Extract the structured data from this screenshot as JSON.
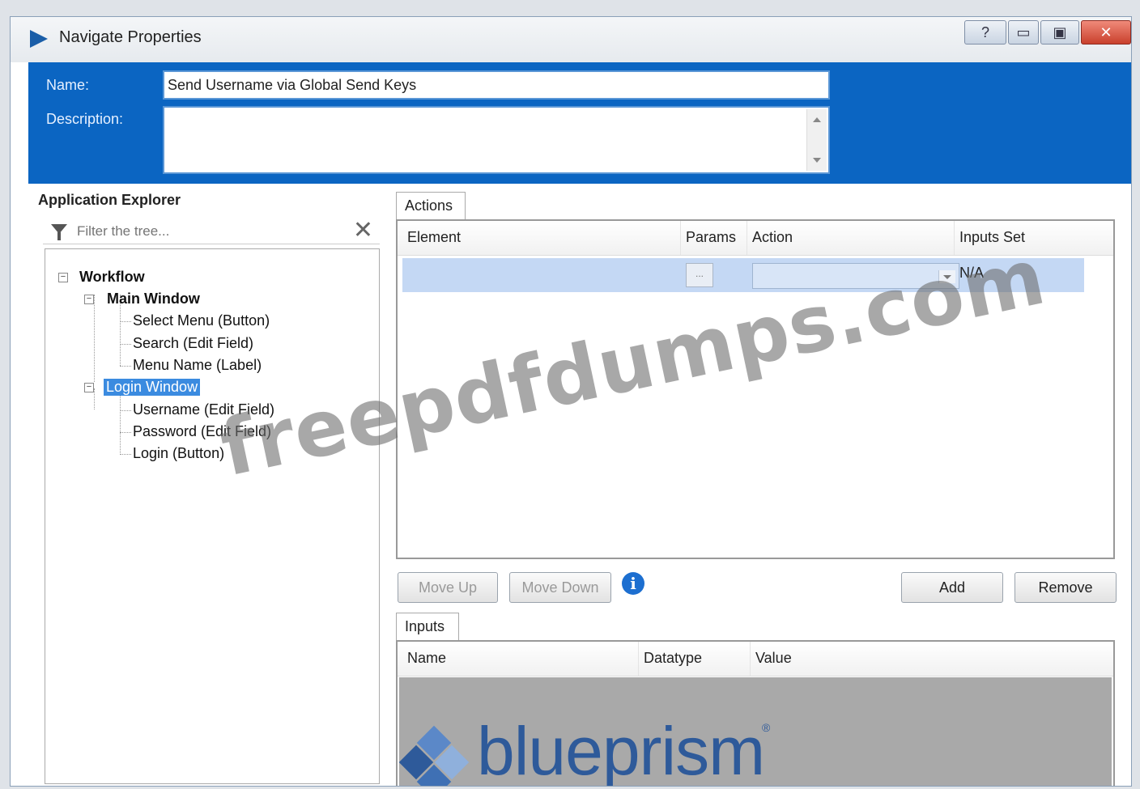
{
  "window": {
    "title": "Navigate Properties",
    "controls": {
      "help": "?",
      "minimize": "▭",
      "maximize": "▣",
      "close": "✕"
    }
  },
  "header": {
    "name_label": "Name:",
    "name_value": "Send Username via Global Send Keys",
    "description_label": "Description:",
    "description_value": ""
  },
  "explorer": {
    "title": "Application Explorer",
    "filter_placeholder": "Filter the tree...",
    "clear": "✕",
    "tree": {
      "root": "Workflow",
      "main_window": "Main Window",
      "main_children": [
        "Select Menu (Button)",
        "Search (Edit Field)",
        "Menu Name (Label)"
      ],
      "login_window": "Login Window",
      "login_children": [
        "Username (Edit Field)",
        "Password (Edit Field)",
        "Login (Button)"
      ]
    }
  },
  "actions": {
    "tab": "Actions",
    "columns": [
      "Element",
      "Params",
      "Action",
      "Inputs Set"
    ],
    "row": {
      "element": "",
      "params": "...",
      "action": "",
      "inputs_set": "N/A"
    }
  },
  "buttons": {
    "move_up": "Move Up",
    "move_down": "Move Down",
    "info": "i",
    "add": "Add",
    "remove": "Remove"
  },
  "inputs": {
    "tab": "Inputs",
    "columns": [
      "Name",
      "Datatype",
      "Value"
    ]
  },
  "watermark": "freepdfdumps.com",
  "logo": {
    "text": "blueprism",
    "mark": "®",
    "color": "#2e5a9a"
  },
  "colors": {
    "header_blue": "#0b65c2",
    "selection": "#3b8be0",
    "row_selected": "#c4d8f4"
  }
}
